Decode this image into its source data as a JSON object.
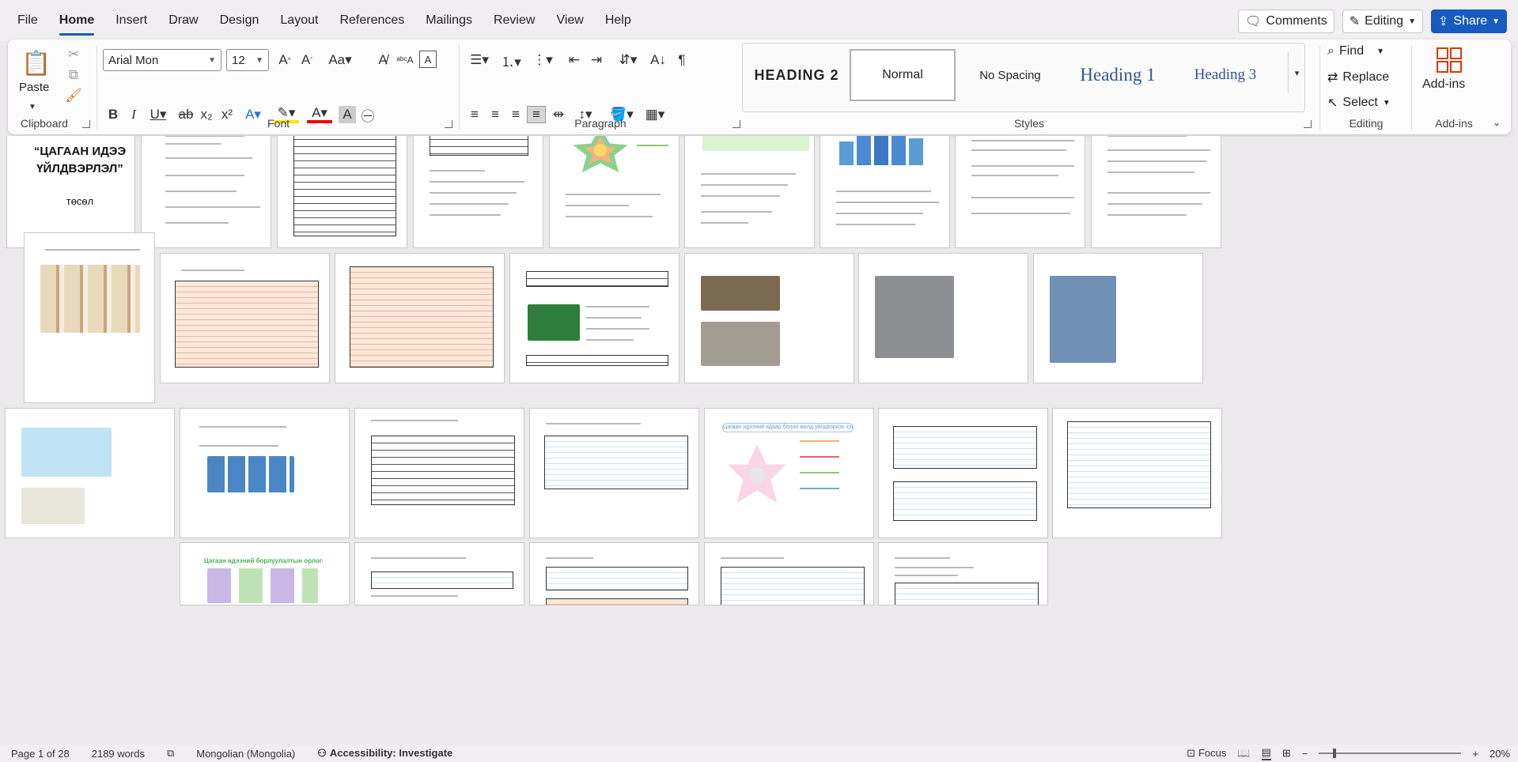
{
  "menu": {
    "tabs": [
      "File",
      "Home",
      "Insert",
      "Draw",
      "Design",
      "Layout",
      "References",
      "Mailings",
      "Review",
      "View",
      "Help"
    ],
    "active": "Home",
    "comments_label": "Comments",
    "editing_label": "Editing",
    "share_label": "Share"
  },
  "ribbon": {
    "clipboard": {
      "label": "Clipboard",
      "paste_label": "Paste"
    },
    "font": {
      "label": "Font",
      "font_name": "Arial Mon",
      "font_size": "12"
    },
    "paragraph": {
      "label": "Paragraph"
    },
    "styles": {
      "label": "Styles",
      "items": [
        "HEADING 2",
        "Normal",
        "No Spacing",
        "Heading 1",
        "Heading 3"
      ],
      "selected": "Normal"
    },
    "editing": {
      "label": "Editing",
      "find": "Find",
      "replace": "Replace",
      "select": "Select"
    },
    "addins": {
      "label": "Add-ins",
      "button": "Add-ins"
    }
  },
  "document": {
    "cover_title": "“ЦАГААН ИДЭЭ ҮЙЛДВЭРЛЭЛ”",
    "cover_sub": "төсөл",
    "diagram_banner": "Цагаан идээний ядаар болон жилд үйлдвэрлэх хэмжээ",
    "diagram_chart_title": "Цагаан идээний борлуулалтын орлого"
  },
  "status": {
    "page": "Page 1 of 28",
    "words": "2189 words",
    "language": "Mongolian (Mongolia)",
    "accessibility": "Accessibility: Investigate",
    "focus": "Focus",
    "zoom": "20%"
  },
  "colors": {
    "accent": "#185abd",
    "table_blue": "#cfe3f2",
    "table_orange": "#fde7d9"
  }
}
